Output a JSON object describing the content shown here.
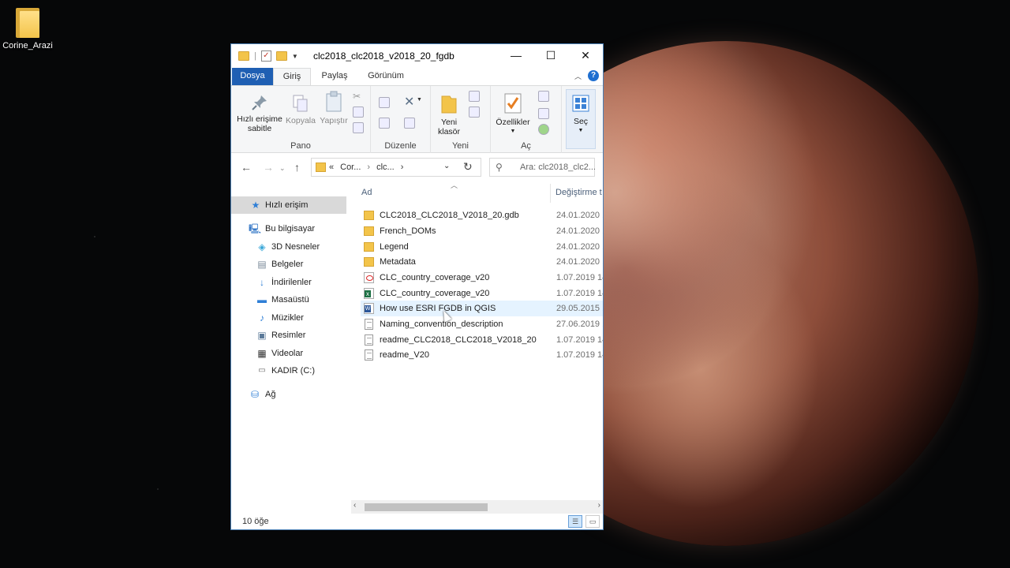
{
  "desktop": {
    "icon_label": "Corine_Arazi"
  },
  "window": {
    "title": "clc2018_clc2018_v2018_20_fgdb",
    "controls": {
      "minimize": "—",
      "maximize": "☐",
      "close": "✕"
    }
  },
  "ribbon_tabs": {
    "file": "Dosya",
    "home": "Giriş",
    "share": "Paylaş",
    "view": "Görünüm"
  },
  "ribbon": {
    "pin_label": "Hızlı erişime sabitle",
    "copy_label": "Kopyala",
    "paste_label": "Yapıştır",
    "group_clipboard": "Pano",
    "group_organize": "Düzenle",
    "new_folder_label": "Yeni klasör",
    "group_new": "Yeni",
    "properties_label": "Özellikler",
    "group_open": "Aç",
    "select_label": "Seç"
  },
  "address": {
    "crumbs": [
      "«",
      "Cor...",
      "clc...",
      "›"
    ],
    "search_placeholder": "Ara: clc2018_clc2..."
  },
  "navpane": {
    "items": [
      {
        "label": "Hızlı erişim",
        "icon": "star-icon"
      },
      {
        "label": "Bu bilgisayar",
        "icon": "computer-icon"
      },
      {
        "label": "3D Nesneler",
        "icon": "cube-icon"
      },
      {
        "label": "Belgeler",
        "icon": "documents-icon"
      },
      {
        "label": "İndirilenler",
        "icon": "download-icon"
      },
      {
        "label": "Masaüstü",
        "icon": "desktop-icon"
      },
      {
        "label": "Müzikler",
        "icon": "music-icon"
      },
      {
        "label": "Resimler",
        "icon": "pictures-icon"
      },
      {
        "label": "Videolar",
        "icon": "video-icon"
      },
      {
        "label": "KADIR (C:)",
        "icon": "drive-icon"
      },
      {
        "label": "Ağ",
        "icon": "network-icon"
      }
    ]
  },
  "files": {
    "col_name": "Ad",
    "col_date": "Değiştirme t",
    "rows": [
      {
        "name": "CLC2018_CLC2018_V2018_20.gdb",
        "date": "24.01.2020 1",
        "type": "folder"
      },
      {
        "name": "French_DOMs",
        "date": "24.01.2020 1",
        "type": "folder"
      },
      {
        "name": "Legend",
        "date": "24.01.2020 1",
        "type": "folder"
      },
      {
        "name": "Metadata",
        "date": "24.01.2020 1",
        "type": "folder"
      },
      {
        "name": "CLC_country_coverage_v20",
        "date": "1.07.2019 14",
        "type": "pdf"
      },
      {
        "name": "CLC_country_coverage_v20",
        "date": "1.07.2019 14",
        "type": "xls"
      },
      {
        "name": "How use ESRI FGDB in QGIS",
        "date": "29.05.2015 1",
        "type": "doc"
      },
      {
        "name": "Naming_convention_description",
        "date": "27.06.2019 1",
        "type": "txt"
      },
      {
        "name": "readme_CLC2018_CLC2018_V2018_20",
        "date": "1.07.2019 14",
        "type": "txt"
      },
      {
        "name": "readme_V20",
        "date": "1.07.2019 14",
        "type": "txt"
      }
    ]
  },
  "status": {
    "item_count": "10 öğe"
  }
}
